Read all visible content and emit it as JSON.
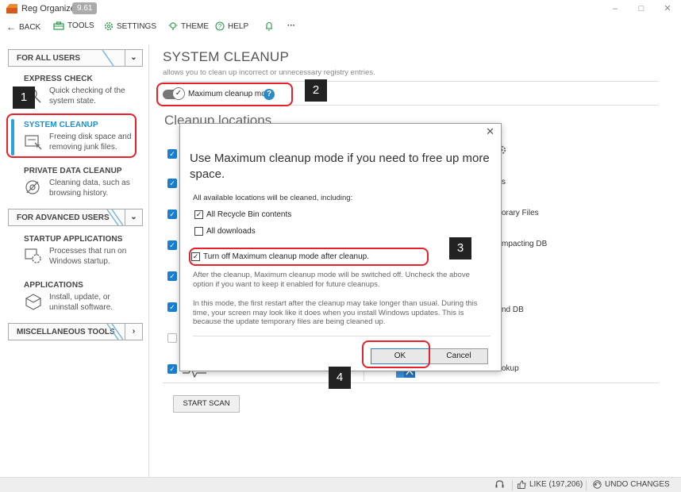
{
  "window": {
    "app_name": "Reg Organizer",
    "version": "9.61",
    "minimize": "–",
    "maximize": "□",
    "close": "✕"
  },
  "toolbar": {
    "back": "BACK",
    "tools": "TOOLS",
    "settings": "SETTINGS",
    "theme": "THEME",
    "help": "HELP",
    "more": "···"
  },
  "sidebar": {
    "section_for_all": "FOR ALL USERS",
    "express_check_title": "EXPRESS CHECK",
    "express_check_desc": "Quick checking of the system state.",
    "system_cleanup_title": "SYSTEM CLEANUP",
    "system_cleanup_desc": "Freeing disk space and removing junk files.",
    "private_title": "PRIVATE DATA CLEANUP",
    "private_desc": "Cleaning data, such as browsing history.",
    "section_advanced": "FOR ADVANCED USERS",
    "startup_title": "STARTUP APPLICATIONS",
    "startup_desc": "Processes that run on Windows startup.",
    "apps_title": "APPLICATIONS",
    "apps_desc": "Install, update, or uninstall software.",
    "section_misc": "MISCELLANEOUS TOOLS"
  },
  "main": {
    "title": "SYSTEM CLEANUP",
    "subtitle": "allows you to clean up incorrect or unnecessary registry entries.",
    "max_cleanup_label": "Maximum cleanup mode",
    "help_glyph": "?",
    "cleanup_locations": "Cleanup locations",
    "right_partial_1": "s",
    "right_partial_2": "orary Files",
    "right_partial_3": "mpacting DB",
    "right_partial_4": "nd DB",
    "right_partial_5": "okup",
    "start_scan": "START SCAN"
  },
  "dialog": {
    "close": "✕",
    "heading": "Use Maximum cleanup mode if you need to free up more space.",
    "included_label": "All available locations will be cleaned, including:",
    "opt_recycle": "All Recycle Bin contents",
    "opt_downloads": "All downloads",
    "opt_turn_off": "Turn off Maximum cleanup mode after cleanup.",
    "note_1": "After the cleanup, Maximum cleanup mode will be switched off. Uncheck the above option if you want to keep it enabled for future cleanups.",
    "note_2": "In this mode, the first restart after the cleanup may take longer than usual. During this time, your screen may look like it does when you install Windows updates. This is because the update temporary files are being cleaned up.",
    "ok": "OK",
    "cancel": "Cancel",
    "recycle_checked": true,
    "downloads_checked": false,
    "turn_off_checked": true
  },
  "markers": {
    "m1": "1",
    "m2": "2",
    "m3": "3",
    "m4": "4"
  },
  "statusbar": {
    "like": "LIKE (197,206)",
    "undo": "UNDO CHANGES"
  },
  "colors": {
    "accent": "#29a3e0",
    "highlight": "#e8202a",
    "checkbox_blue": "#1a7fd0"
  },
  "checkmark": "✓"
}
